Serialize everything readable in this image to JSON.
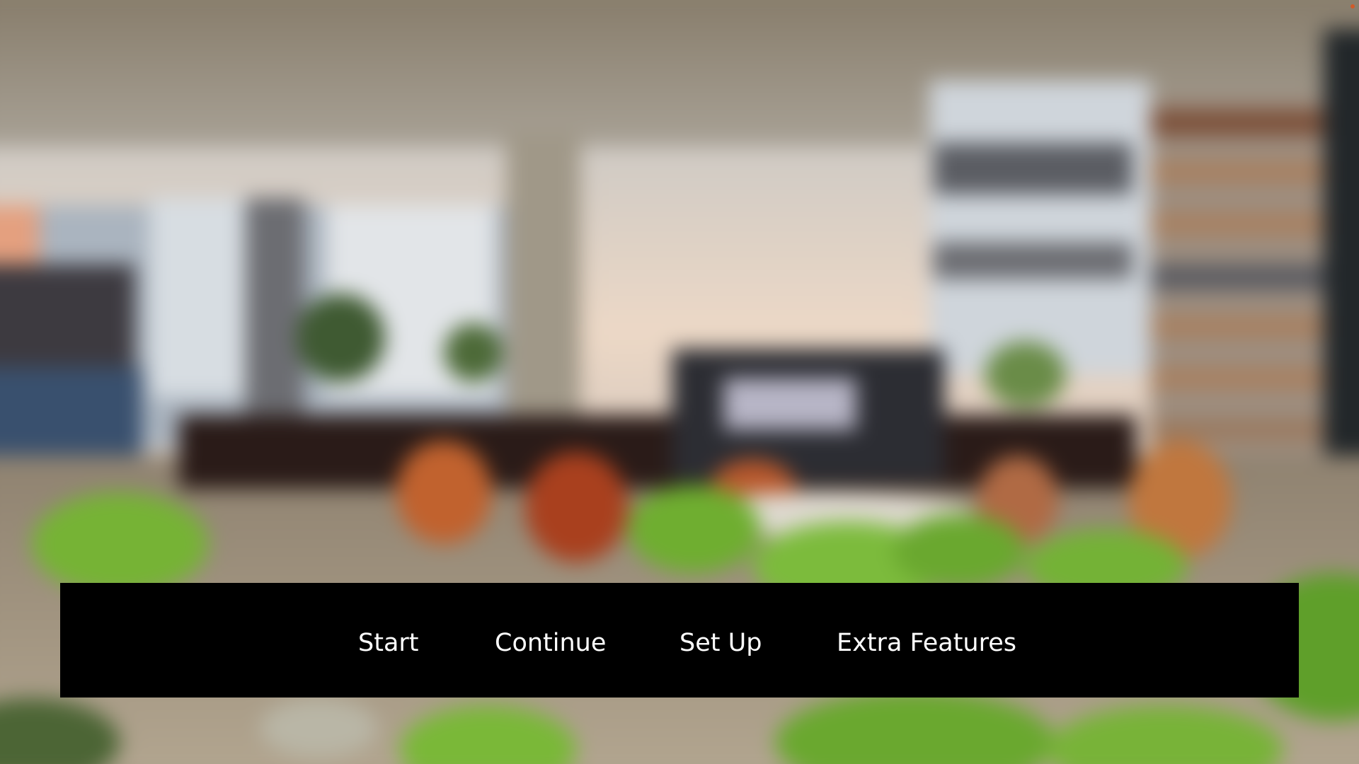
{
  "background": {
    "scene": "blurred-lobby-lounge"
  },
  "menu": {
    "items": [
      {
        "label": "Start"
      },
      {
        "label": "Continue"
      },
      {
        "label": "Set Up"
      },
      {
        "label": "Extra Features"
      }
    ]
  },
  "colors": {
    "menu_bar": "#000000",
    "menu_text": "#ffffff"
  }
}
